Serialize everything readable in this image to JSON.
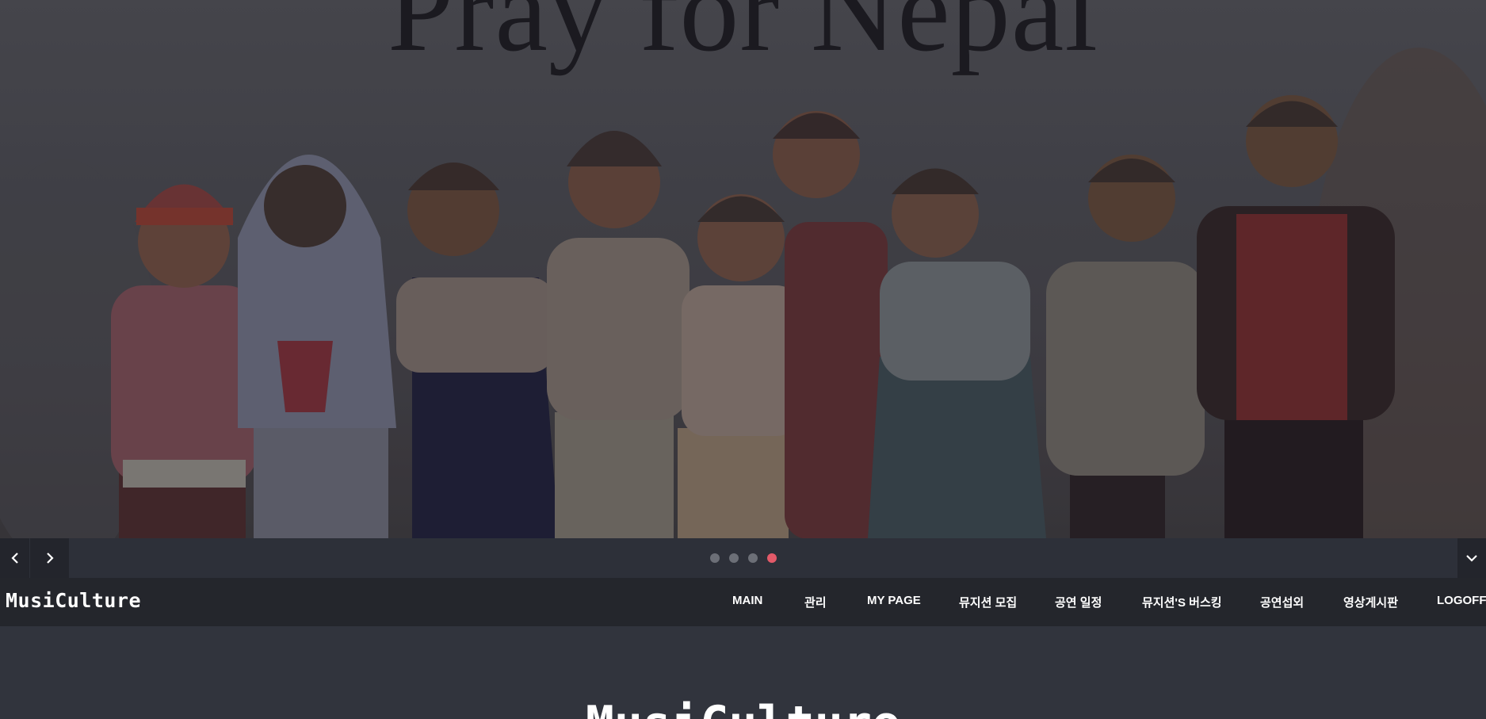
{
  "hero": {
    "title": "Pray for Nepal"
  },
  "slider": {
    "dots": [
      {
        "active": false
      },
      {
        "active": false
      },
      {
        "active": false
      },
      {
        "active": true
      }
    ],
    "colors": {
      "dot": "#6c6f77",
      "dot_active": "#e35a69"
    },
    "icons": {
      "prev": "chevron-left-icon",
      "next": "chevron-right-icon",
      "toggle": "chevron-down-icon"
    }
  },
  "navbar": {
    "brand": "MusiCulture",
    "items": [
      {
        "label": "MAIN"
      },
      {
        "label": "관리"
      },
      {
        "label": "MY PAGE"
      },
      {
        "label": "뮤지션 모집"
      },
      {
        "label": "공연 일정"
      },
      {
        "label": "뮤지션'S 버스킹"
      },
      {
        "label": "공연섭외"
      },
      {
        "label": "영상게시판"
      },
      {
        "label": "LOGOFF"
      }
    ]
  },
  "content": {
    "title": "MusiCulture"
  }
}
